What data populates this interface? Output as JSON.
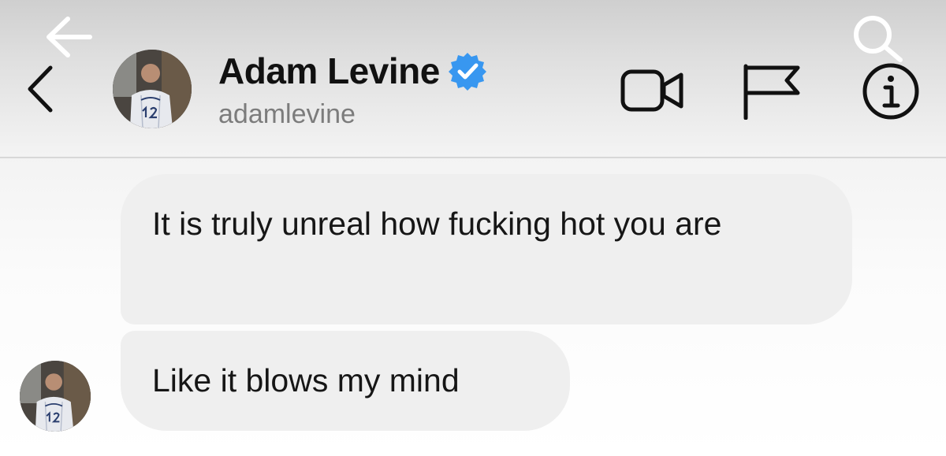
{
  "overlay": {
    "back_icon": "arrow-left-icon",
    "search_icon": "search-icon"
  },
  "header": {
    "back_icon": "chevron-left-icon",
    "display_name": "Adam Levine",
    "username": "adamlevine",
    "verified_icon": "verified-badge-icon",
    "verified_color": "#3897f0",
    "actions": [
      {
        "icon": "video-call-icon"
      },
      {
        "icon": "flag-icon"
      },
      {
        "icon": "info-icon"
      }
    ]
  },
  "conversation": {
    "messages": [
      {
        "text": "It is truly unreal how fucking hot you are"
      },
      {
        "text": "Like it blows my mind"
      }
    ]
  },
  "colors": {
    "bubble_background": "#efefef",
    "primary_text": "#111111",
    "secondary_text": "#7c7c7c"
  }
}
